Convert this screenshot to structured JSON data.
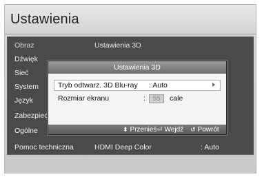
{
  "header": {
    "title": "Ustawienia"
  },
  "sidebar": {
    "items": [
      {
        "label": "Obraz"
      },
      {
        "label": "Dźwięk"
      },
      {
        "label": "Sieć"
      },
      {
        "label": "System"
      },
      {
        "label": "Język"
      },
      {
        "label": "Zabezpiecz"
      },
      {
        "label": "Ogólne"
      },
      {
        "label": "Pomoc techniczna"
      }
    ],
    "top_value": "Ustawienia 3D",
    "hdmi_label": "HDMI Deep Color",
    "hdmi_value": ": Auto"
  },
  "dialog": {
    "title": "Ustawienia 3D",
    "rows": [
      {
        "label": "Tryb odtwarz. 3D Blu-ray",
        "value": ": Auto"
      },
      {
        "label": "Rozmiar ekranu",
        "value_prefix": ":",
        "value": "55",
        "unit": "cale"
      }
    ],
    "footer": {
      "move": "Przenieś",
      "enter": "Wejdź",
      "back": "Powrót"
    }
  }
}
